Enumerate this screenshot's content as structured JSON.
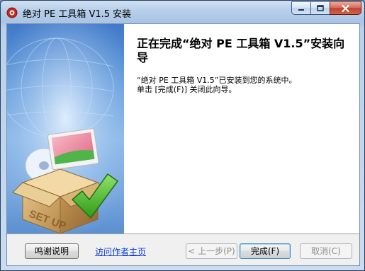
{
  "window": {
    "title": "绝对 PE 工具箱 V1.5 安装",
    "min_glyph": "—",
    "max_glyph": "☐",
    "close_glyph": "✕"
  },
  "content": {
    "heading": "正在完成“绝对 PE 工具箱 V1.5”安装向导",
    "line1": "“绝对 PE 工具箱 V1.5”已安装到您的系统中。",
    "line2": "单击 [完成(F)] 关闭此向导。"
  },
  "banner": {
    "box_text": "SET UP"
  },
  "footer": {
    "thanks_button": "鸣谢说明",
    "author_link": "访问作者主页",
    "back_button": "< 上一步(P)",
    "finish_button": "完成(F)",
    "cancel_button": "取消(C)"
  },
  "colors": {
    "banner_blue": "#5b8fd0",
    "link": "#0b3de0",
    "check_green": "#3fb31f"
  }
}
